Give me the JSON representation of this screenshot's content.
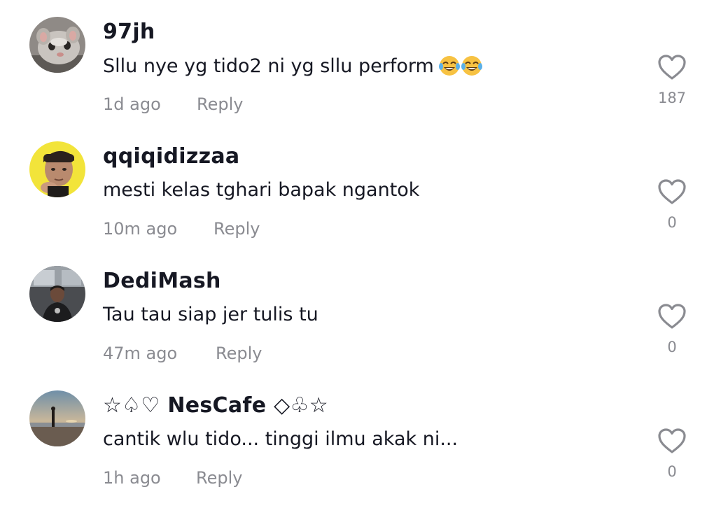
{
  "comments": [
    {
      "username": "97jh",
      "text": "Sllu nye yg tido2 ni yg sllu perform",
      "emoji": [
        "face-with-tears-of-joy-icon",
        "face-with-tears-of-joy-icon"
      ],
      "time": "1d ago",
      "reply_label": "Reply",
      "likes": "187",
      "avatar_icon": "cat-avatar-icon"
    },
    {
      "username": "qqiqidizzaa",
      "text": "mesti kelas tghari bapak ngantok",
      "time": "10m ago",
      "reply_label": "Reply",
      "likes": "0",
      "avatar_icon": "person-yellow-avatar-icon"
    },
    {
      "username": "DediMash",
      "text": "Tau tau siap jer tulis tu",
      "time": "47m ago",
      "reply_label": "Reply",
      "likes": "0",
      "avatar_icon": "person-in-car-avatar-icon"
    },
    {
      "username": "☆♤♡ NesCafe ◇♧☆",
      "text": "cantik wlu tido... tinggi ilmu akak ni...",
      "time": "1h ago",
      "reply_label": "Reply",
      "likes": "0",
      "avatar_icon": "beach-sunset-avatar-icon"
    }
  ],
  "colors": {
    "primary_text": "#161823",
    "secondary_text": "#8a8b91",
    "heart_outline": "#8a8b91",
    "background": "#ffffff"
  }
}
